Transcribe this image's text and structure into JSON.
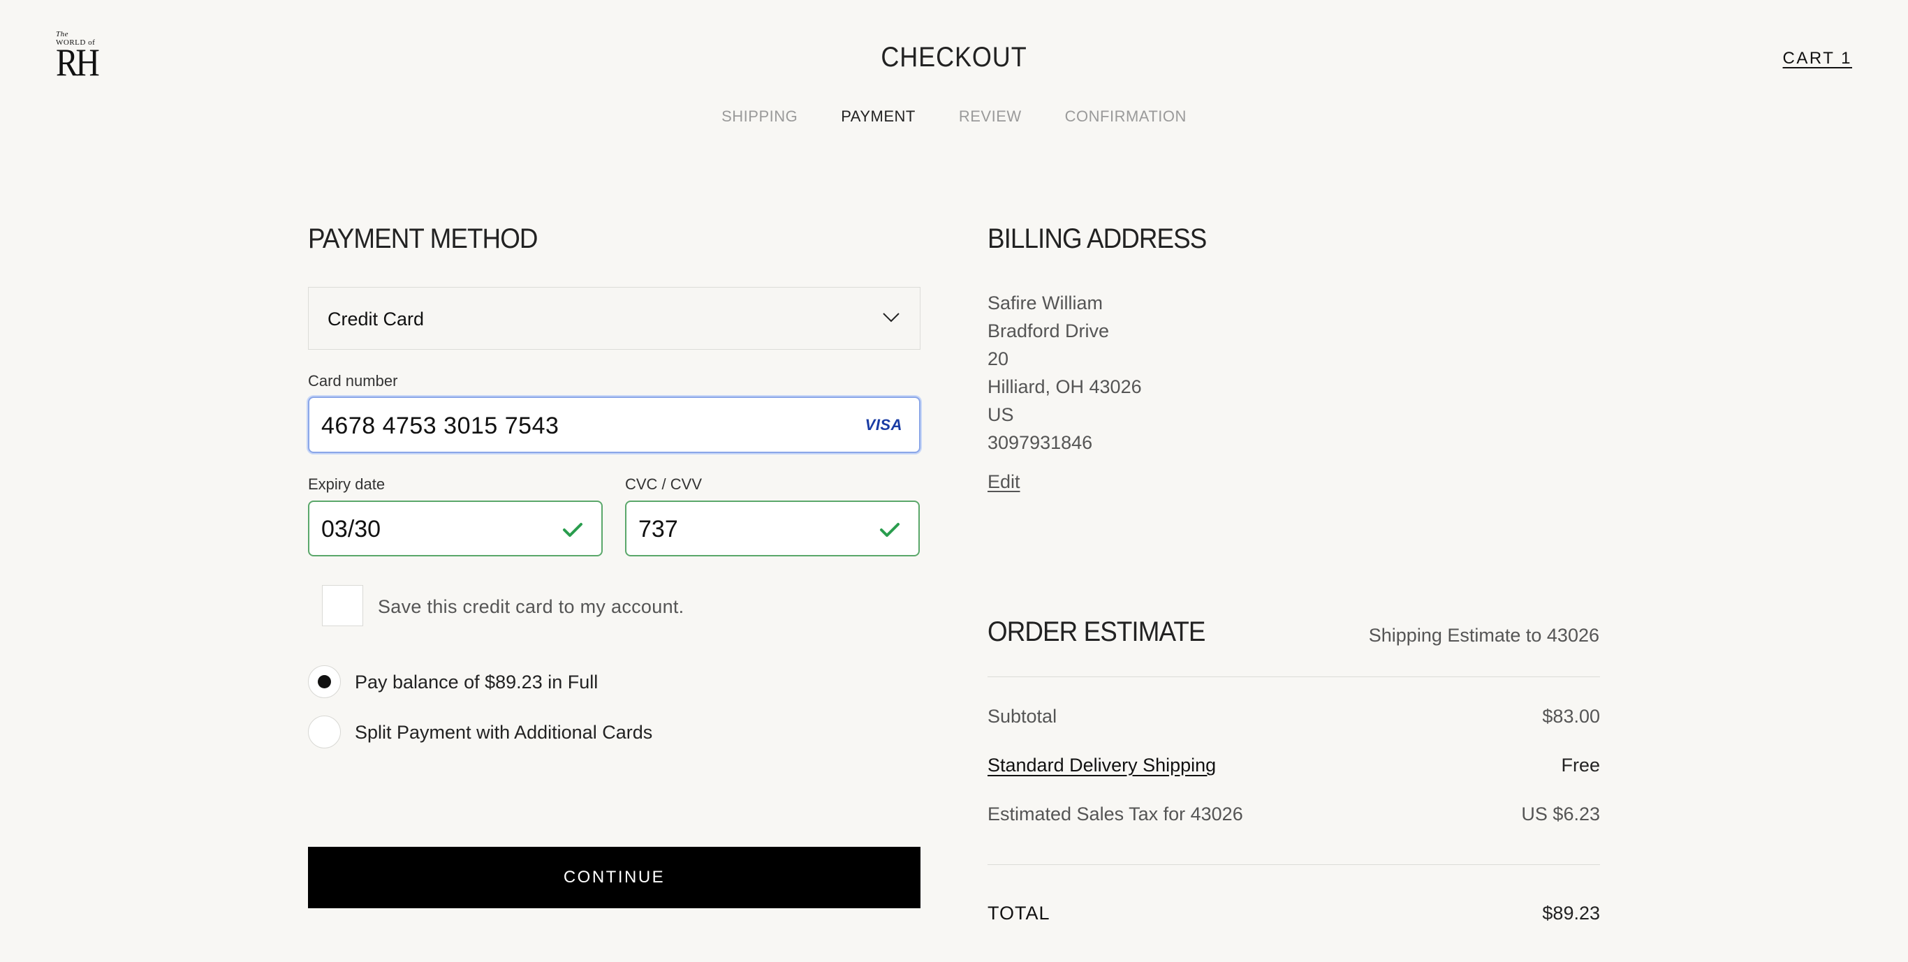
{
  "header": {
    "logo": {
      "line1": "The",
      "line2": "WORLD of",
      "mark": "RH"
    },
    "title": "CHECKOUT",
    "cart_label": "CART 1"
  },
  "steps": [
    {
      "label": "SHIPPING",
      "active": false
    },
    {
      "label": "PAYMENT",
      "active": true
    },
    {
      "label": "REVIEW",
      "active": false
    },
    {
      "label": "CONFIRMATION",
      "active": false
    }
  ],
  "payment": {
    "heading": "PAYMENT METHOD",
    "method_selected": "Credit Card",
    "card_number_label": "Card number",
    "card_number_value": "4678 4753 3015 7543",
    "card_brand": "VISA",
    "expiry_label": "Expiry date",
    "expiry_value": "03/30",
    "cvc_label": "CVC / CVV",
    "cvc_value": "737",
    "save_card_label": "Save this credit card to my account.",
    "save_card_checked": false,
    "options": [
      {
        "label": "Pay balance of $89.23 in Full",
        "selected": true
      },
      {
        "label": "Split Payment with Additional Cards",
        "selected": false
      }
    ],
    "continue_label": "CONTINUE"
  },
  "billing": {
    "heading": "BILLING ADDRESS",
    "lines": [
      "Safire William",
      "Bradford Drive",
      "20",
      "Hilliard, OH 43026",
      "US",
      "3097931846"
    ],
    "edit_label": "Edit"
  },
  "order": {
    "heading": "ORDER ESTIMATE",
    "shipping_estimate": "Shipping Estimate to 43026",
    "subtotal_label": "Subtotal",
    "subtotal_value": "$83.00",
    "shipping_label": "Standard Delivery Shipping",
    "shipping_value": "Free",
    "tax_label": "Estimated Sales Tax for 43026",
    "tax_value": "US $6.23",
    "total_label": "TOTAL",
    "total_value": "$89.23"
  },
  "colors": {
    "background": "#f8f7f4",
    "button": "#000000",
    "focus_border": "#8aa6e8",
    "valid_border": "#5aa76a",
    "check": "#2a9d4e",
    "visa": "#1a3ca4"
  }
}
